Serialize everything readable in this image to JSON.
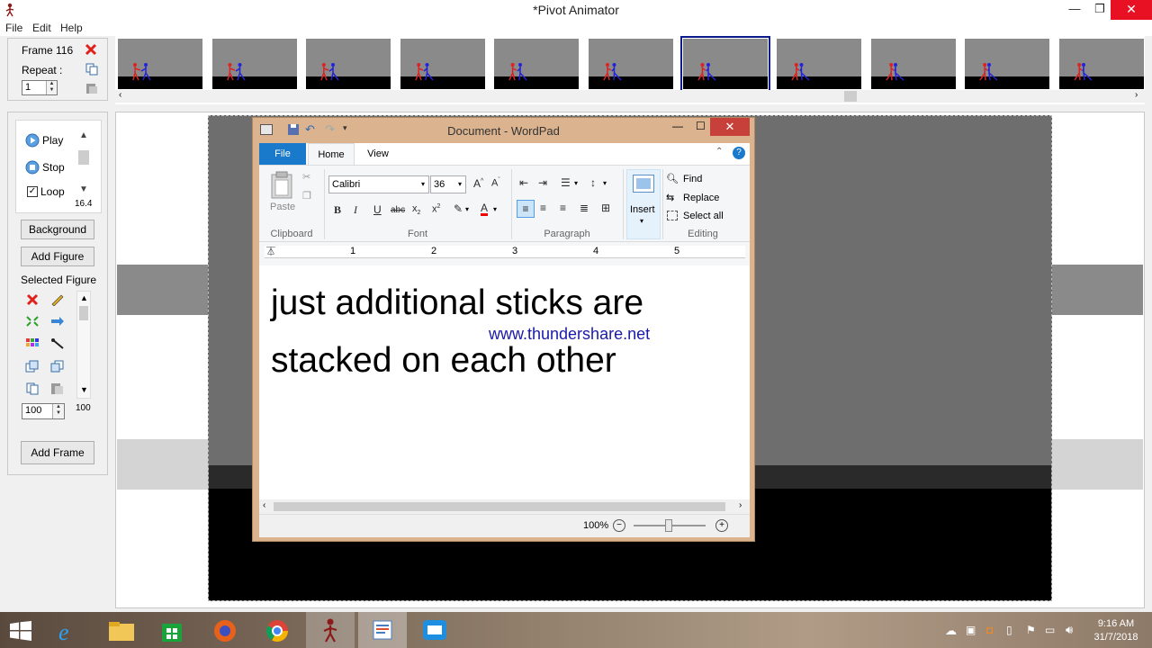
{
  "window": {
    "title": "*Pivot Animator",
    "controls": {
      "minimize": "—",
      "maximize": "❐",
      "close": "✕"
    }
  },
  "menu": [
    "File",
    "Edit",
    "Help"
  ],
  "frame_panel": {
    "frame_label": "Frame 116",
    "repeat_label": "Repeat :",
    "repeat_value": "1"
  },
  "playback": {
    "play": "Play",
    "stop": "Stop",
    "loop": "Loop",
    "loop_checked": true,
    "speed": "16.4"
  },
  "buttons": {
    "background": "Background",
    "add_figure": "Add Figure",
    "selected_figure": "Selected Figure",
    "add_frame": "Add Frame"
  },
  "figure_scale": {
    "value": "100",
    "display": "100"
  },
  "filmstrip": {
    "frames": 11,
    "selected_index": 6
  },
  "wordpad": {
    "title": "Document - WordPad",
    "tabs": [
      "File",
      "Home",
      "View"
    ],
    "active_tab": "Home",
    "clipboard": {
      "paste": "Paste",
      "label": "Clipboard"
    },
    "font": {
      "family": "Calibri",
      "size": "36",
      "label": "Font"
    },
    "paragraph_label": "Paragraph",
    "insert": "Insert",
    "editing": {
      "find": "Find",
      "replace": "Replace",
      "select_all": "Select all",
      "label": "Editing"
    },
    "ruler_numbers": [
      "1",
      "2",
      "3",
      "4",
      "5"
    ],
    "document": {
      "line1": "just additional sticks are",
      "watermark": "www.thundershare.net",
      "line2": "stacked on each other"
    },
    "zoom": "100%"
  },
  "taskbar": {
    "time": "9:16 AM",
    "date": "31/7/2018"
  },
  "colors": {
    "selection_frame": "#0a1a8a",
    "close_red": "#e81123",
    "wordpad_file_tab": "#1979ca",
    "watermark_blue": "#1a1aa8"
  }
}
